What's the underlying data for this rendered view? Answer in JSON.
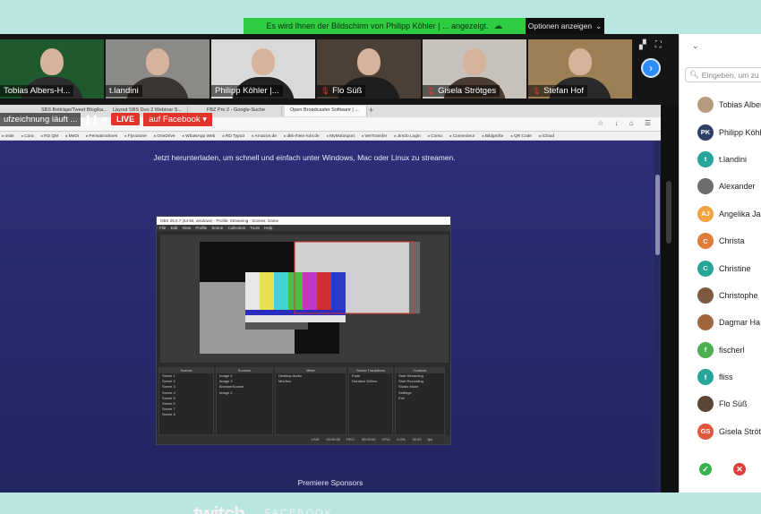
{
  "share_banner": {
    "text": "Es wird Ihnen der Bildschirm von Philipp Köhler | ... angezeigt.",
    "options_label": "Optionen anzeigen",
    "cloud_icon": "cloud-icon",
    "chevron_icon": "chevron-down-icon"
  },
  "thumbnails": [
    {
      "name": "Tobias Albers-H...",
      "muted": false,
      "bg": "#1f5a2e",
      "shirt": "#2d2d2d"
    },
    {
      "name": "t.landini",
      "muted": false,
      "bg": "#8b8a86",
      "shirt": "#3a3530"
    },
    {
      "name": "Philipp Köhler |...",
      "muted": false,
      "bg": "#d9d9d9",
      "shirt": "#222"
    },
    {
      "name": "Flo Süß",
      "muted": true,
      "bg": "#4c4036",
      "shirt": "#1e1e1e"
    },
    {
      "name": "Gisela Strötges",
      "muted": true,
      "bg": "#c6c2bb",
      "shirt": "#4a3b33"
    },
    {
      "name": "Stefan Hof",
      "muted": true,
      "bg": "#9c7f55",
      "shirt": "#2a2a2a"
    }
  ],
  "recording": {
    "status_text": "ufzeichnung läuft ...",
    "live_label": "LIVE",
    "target_label": "auf Facebook"
  },
  "browser": {
    "tabs": [
      "SBS Beiträge/Tweet Blog/ka...",
      "Layout SBS Duo 2 Webinar S...",
      "FBZ Pro 2 - Google-Suche",
      "Open Broadcaster Software | ..."
    ],
    "bookmarks": [
      "osite",
      "Cora",
      "RD QM",
      "MeDi",
      "Pensatrocknes",
      "Flyoutone",
      "OneDrive",
      "WhatsApp Web",
      "RD Typo3",
      "Amazon.de",
      "dkk-rhein-ruhr.de",
      "MyMotosport",
      "WeTransfer",
      "Jimdo Login",
      "Corso",
      "Connecteur",
      "Bildgröße",
      "QR Code",
      "iCloud"
    ],
    "headline": "Jetzt herunterladen, um schnell und einfach unter Windows, Mac oder Linux zu streamen.",
    "sponsors_label": "Premiere Sponsors",
    "logo_twitch": "twitch",
    "logo_facebook": "FACEBOOK"
  },
  "obs": {
    "title": "OBS 25.0.7 (64-bit, windows) - Profile: Streaming - Scenes: Game",
    "menu": "File Edit View Profile Scene Collection Tools Help",
    "panels": {
      "scenes": {
        "title": "Scenes",
        "items": [
          "Scene 1",
          "Scene 2",
          "Scene 3",
          "Scene 4",
          "Scene 5",
          "Scene 6",
          "Scene 7",
          "Scene 8"
        ]
      },
      "sources": {
        "title": "Sources",
        "items": [
          "Image 4",
          "Image 3",
          "BrowserSource",
          "Image 2"
        ]
      },
      "mixer": {
        "title": "Mixer",
        "items": [
          "Desktop Audio",
          "Mic/Aux"
        ]
      },
      "transitions": {
        "title": "Scene Transitions",
        "items": [
          "Fade",
          "Duration 300ms"
        ]
      },
      "controls": {
        "title": "Controls",
        "items": [
          "Start Streaming",
          "Start Recording",
          "Studio Mode",
          "Settings",
          "Exit"
        ]
      }
    },
    "status": "LIVE: 00:00:00 REC: 00:00:00 CPU: 0.4%, 30.00 fps"
  },
  "participants": {
    "search_placeholder": "Eingeben, um zu suchen",
    "list": [
      {
        "name": "Tobias Albers-H",
        "initials": "",
        "color": "#b79b7e"
      },
      {
        "name": "Philipp Köhler",
        "initials": "PK",
        "color": "#2e3f66"
      },
      {
        "name": "t.landini",
        "initials": "t",
        "color": "#26a69a"
      },
      {
        "name": "Alexander",
        "initials": "",
        "color": "#6d6d6d"
      },
      {
        "name": "Angelika Ja",
        "initials": "AJ",
        "color": "#f2a444"
      },
      {
        "name": "Christa",
        "initials": "C",
        "color": "#e07b39"
      },
      {
        "name": "Christine",
        "initials": "C",
        "color": "#26a69a"
      },
      {
        "name": "Christophe",
        "initials": "",
        "color": "#7b5a3d"
      },
      {
        "name": "Dagmar Ha",
        "initials": "",
        "color": "#a0673e"
      },
      {
        "name": "fischerl",
        "initials": "f",
        "color": "#4caf50"
      },
      {
        "name": "fliss",
        "initials": "f",
        "color": "#26a69a"
      },
      {
        "name": "Flo Süß",
        "initials": "",
        "color": "#594636"
      },
      {
        "name": "Gisela Ströt",
        "initials": "GS",
        "color": "#e0573d"
      }
    ],
    "accept_color": "#37b24d",
    "decline_color": "#e0403a"
  }
}
